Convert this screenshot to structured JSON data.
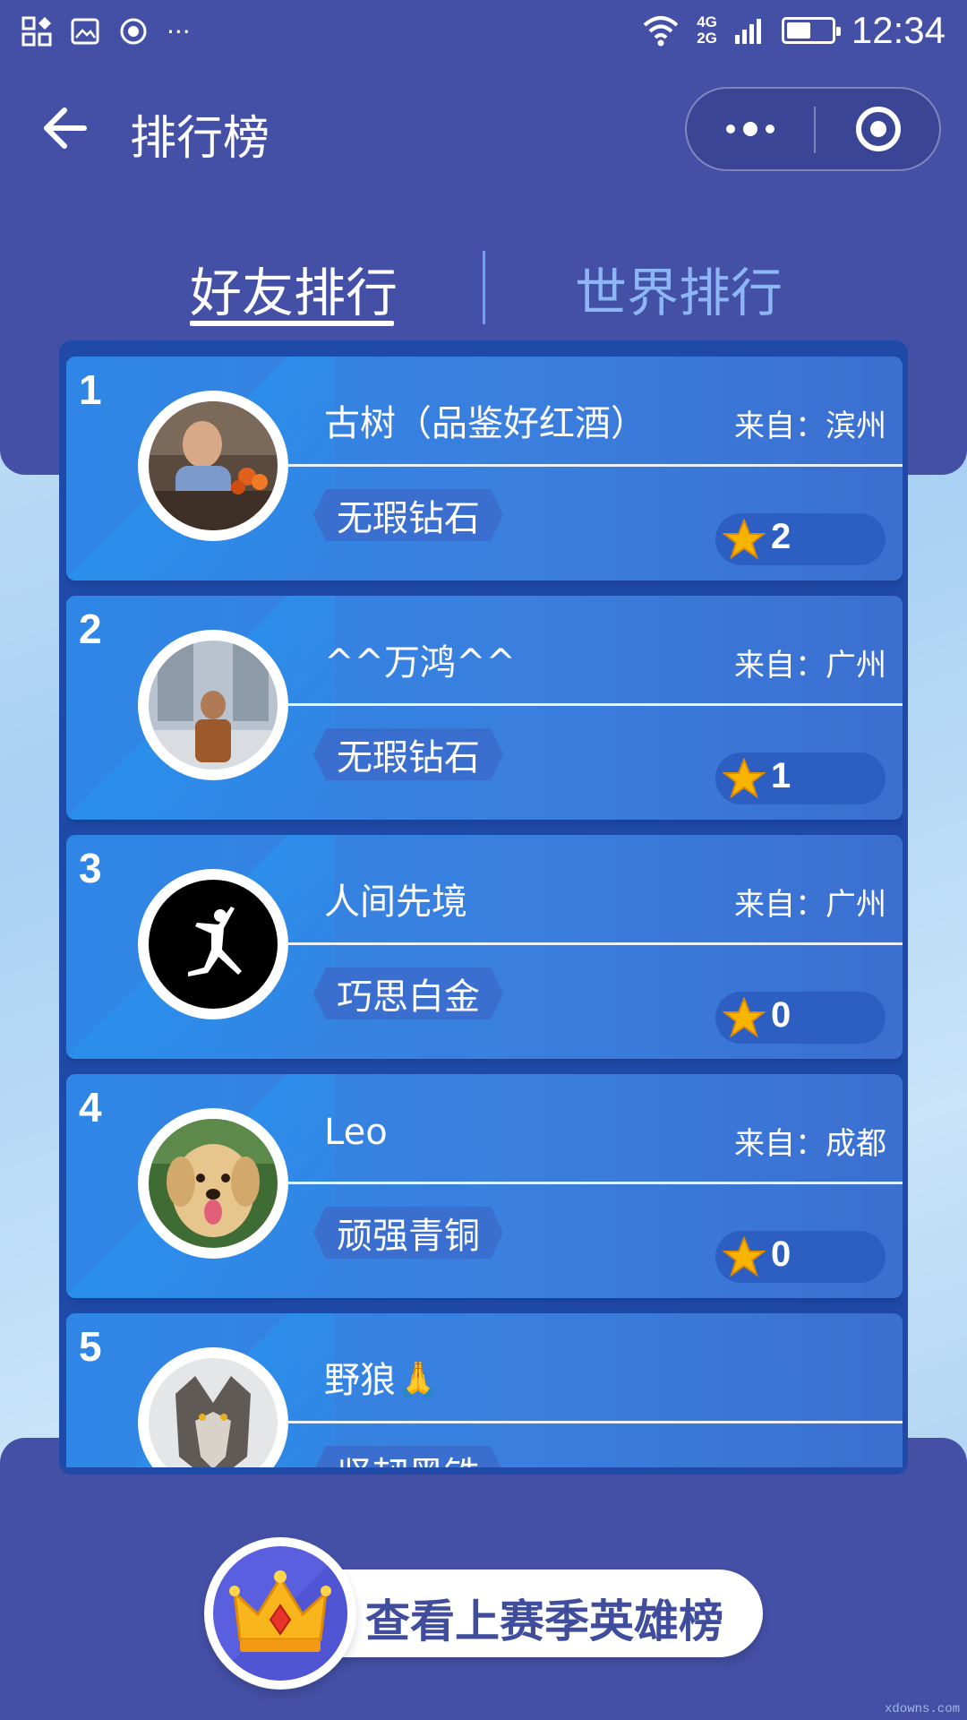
{
  "status_bar": {
    "time": "12:34",
    "network_top": "4G",
    "network_bottom": "2G",
    "battery_level": 0.55,
    "more": "···"
  },
  "nav": {
    "title": "排行榜"
  },
  "tabs": [
    {
      "label": "好友排行",
      "active": true
    },
    {
      "label": "世界排行",
      "active": false
    }
  ],
  "ranking": [
    {
      "rank": "1",
      "name": "古树（品鉴好红酒）",
      "from": "来自：滨州",
      "tier": "无瑕钻石",
      "stars": "2",
      "avatar": "person-avatar"
    },
    {
      "rank": "2",
      "name": "^^万鸿^^",
      "from": "来自：广州",
      "tier": "无瑕钻石",
      "stars": "1",
      "avatar": "person-avatar"
    },
    {
      "rank": "3",
      "name": "人间先境",
      "from": "来自：广州",
      "tier": "巧思白金",
      "stars": "0",
      "avatar": "jumpman-logo"
    },
    {
      "rank": "4",
      "name": "Leo",
      "from": "来自：成都",
      "tier": "顽强青铜",
      "stars": "0",
      "avatar": "dog-avatar"
    },
    {
      "rank": "5",
      "name": "野狼🙏",
      "from": "",
      "tier": "坚韧黑铁",
      "stars": "",
      "avatar": "wolf-avatar"
    }
  ],
  "footer": {
    "hero_button_label": "查看上赛季英雄榜"
  },
  "colors": {
    "panel": "#4450a6",
    "card": "#3a7fde",
    "tab_inactive": "#8db6f5",
    "star": "#f7b500"
  },
  "watermark": "xdowns.com"
}
